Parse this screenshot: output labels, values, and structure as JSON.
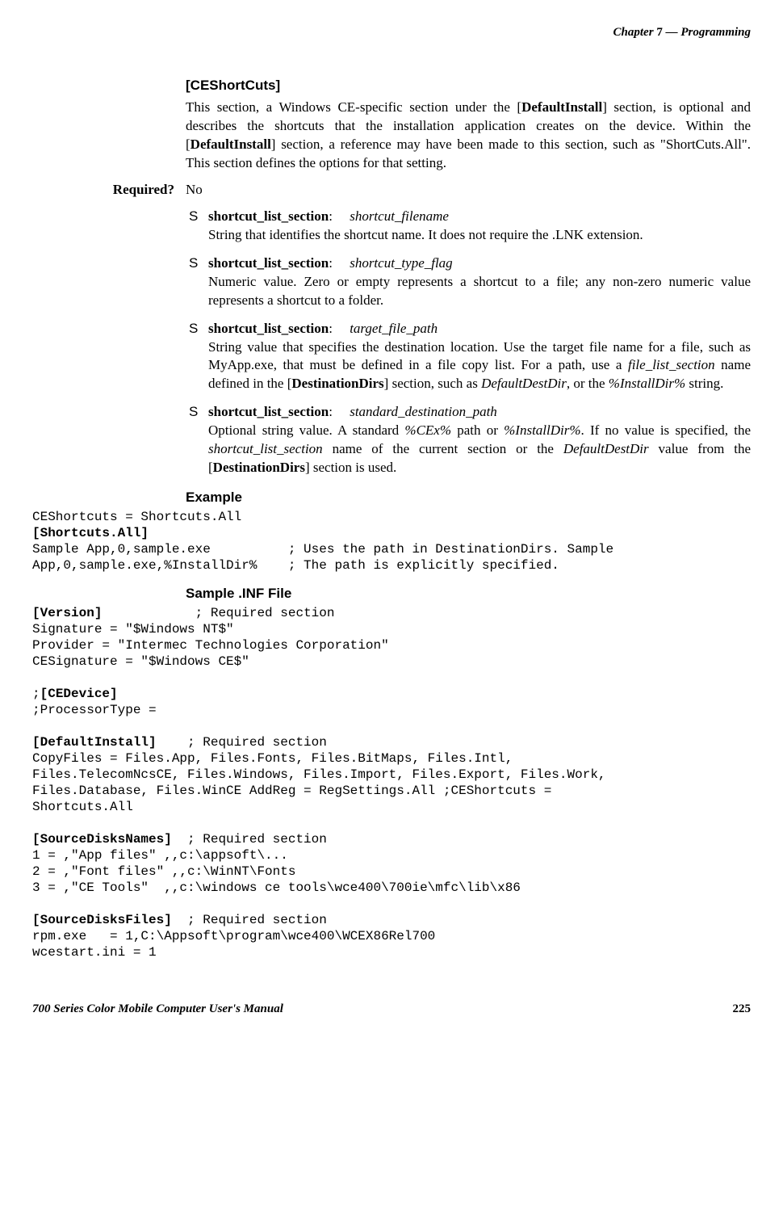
{
  "header": {
    "chapter_prefix": "Chapter",
    "chapter_num": "7",
    "dash": "—",
    "chapter_title": "Programming"
  },
  "section": {
    "title": "[CEShortCuts]",
    "intro_pre": "This section, a Windows CE-specific section under the [",
    "intro_bold1": "DefaultInstall",
    "intro_mid1": "] section, is optional and describes the shortcuts that the installation application creates on the device. Within the [",
    "intro_bold2": "DefaultInstall",
    "intro_post": "] section, a reference may have been made to this section, such as \"ShortCuts.All\". This section defines the options for that setting."
  },
  "required": {
    "label": "Required?",
    "value": "No"
  },
  "bullets": [
    {
      "term": "shortcut_list_section",
      "param": "shortcut_filename",
      "desc": "String that identifies the shortcut name. It does not require the .LNK extension."
    },
    {
      "term": "shortcut_list_section",
      "param": "shortcut_type_flag",
      "desc": "Numeric value. Zero or empty represents a shortcut to a file; any non-zero numeric value represents a shortcut to a folder."
    },
    {
      "term": "shortcut_list_section",
      "param": "target_file_path",
      "desc_pre": "String value that specifies the destination location. Use the target file name for a file, such as MyApp.exe, that must be defined in a file copy list. For a path, use a ",
      "desc_i1": "file_list_section",
      "desc_mid1": " name defined in the [",
      "desc_b1": "DestinationDirs",
      "desc_mid2": "] section, such as ",
      "desc_i2": "DefaultDestDir",
      "desc_mid3": ", or the ",
      "desc_i3": "%InstallDir%",
      "desc_post": " string."
    },
    {
      "term": "shortcut_list_section",
      "param": "standard_destination_path",
      "desc_pre": "Optional string value. A standard ",
      "desc_i1": "%CEx%",
      "desc_mid1": " path or ",
      "desc_i2": "%InstallDir%",
      "desc_mid2": ". If no value is specified, the ",
      "desc_i3": "shortcut_list_section",
      "desc_mid3": " name of the current section or the ",
      "desc_i4": "DefaultDestDir",
      "desc_mid4": " value from the [",
      "desc_b1": "DestinationDirs",
      "desc_post": "] section is used."
    }
  ],
  "example": {
    "heading": "Example",
    "line1": "CEShortcuts = Shortcuts.All",
    "line2": "[Shortcuts.All]",
    "line3": "Sample App,0,sample.exe          ; Uses the path in DestinationDirs. Sample",
    "line4": "App,0,sample.exe,%InstallDir%    ; The path is explicitly specified."
  },
  "sample": {
    "heading": "Sample .INF File",
    "b1": "[Version]",
    "l1": "            ; Required section",
    "l2": "Signature = \"$Windows NT$\"",
    "l3": "Provider = \"Intermec Technologies Corporation\"",
    "l4": "CESignature = \"$Windows CE$\"",
    "l5": "",
    "l6a": ";",
    "b6": "[CEDevice]",
    "l7": ";ProcessorType =",
    "l8": "",
    "b9": "[DefaultInstall]",
    "l9": "    ; Required section",
    "l10": "CopyFiles = Files.App, Files.Fonts, Files.BitMaps, Files.Intl,",
    "l11": "Files.TelecomNcsCE, Files.Windows, Files.Import, Files.Export, Files.Work,",
    "l12": "Files.Database, Files.WinCE AddReg = RegSettings.All ;CEShortcuts =",
    "l13": "Shortcuts.All",
    "l14": "",
    "b15": "[SourceDisksNames]",
    "l15": "  ; Required section",
    "l16": "1 = ,\"App files\" ,,c:\\appsoft\\...",
    "l17": "2 = ,\"Font files\" ,,c:\\WinNT\\Fonts",
    "l18": "3 = ,\"CE Tools\"  ,,c:\\windows ce tools\\wce400\\700ie\\mfc\\lib\\x86",
    "l19": "",
    "b20": "[SourceDisksFiles]",
    "l20": "  ; Required section",
    "l21": "rpm.exe   = 1,C:\\Appsoft\\program\\wce400\\WCEX86Rel700",
    "l22": "wcestart.ini = 1"
  },
  "footer": {
    "manual": "700 Series Color Mobile Computer User's Manual",
    "page": "225"
  }
}
